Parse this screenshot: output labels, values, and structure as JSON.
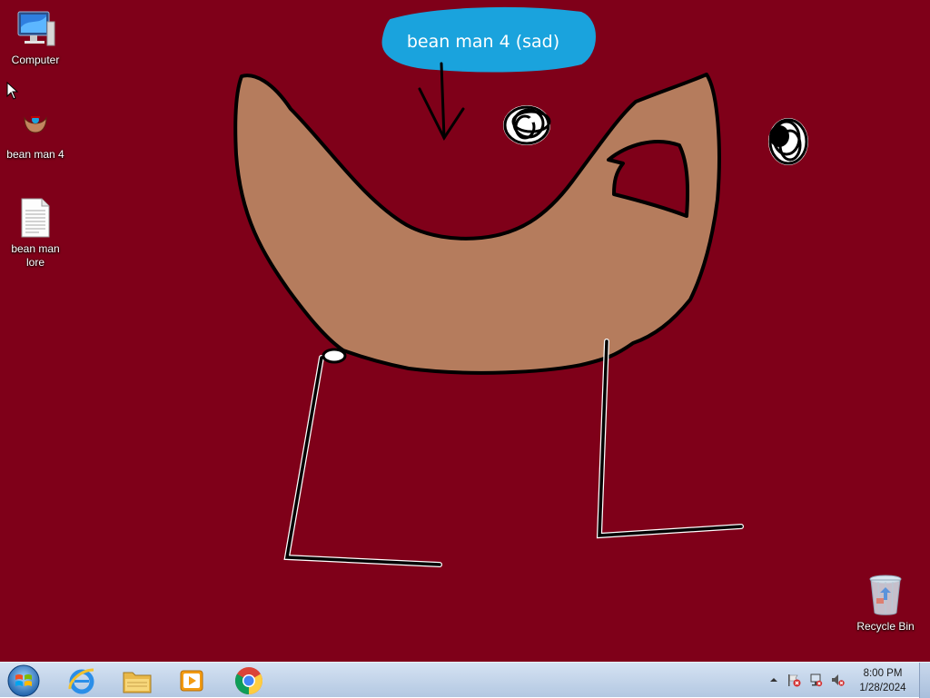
{
  "desktop": {
    "background_color": "#7f0019",
    "icons": [
      {
        "label": "Computer"
      },
      {
        "label": "bean man 4"
      },
      {
        "label": "bean man\nlore"
      },
      {
        "label": "Recycle Bin"
      }
    ]
  },
  "wallpaper": {
    "speech_bubble_text": "bean man 4 (sad)",
    "bubble_color": "#1aa3dd",
    "body_color": "#b57c5d"
  },
  "taskbar": {
    "pinned": [
      {
        "icon": "start-orb-icon"
      },
      {
        "icon": "internet-explorer-icon"
      },
      {
        "icon": "file-explorer-icon"
      },
      {
        "icon": "media-player-icon"
      },
      {
        "icon": "chrome-icon"
      }
    ],
    "tray": {
      "icons": [
        "show-hidden-icons-chevron",
        "action-center-flag-icon",
        "network-icon",
        "volume-muted-icon"
      ],
      "time": "8:00 PM",
      "date": "1/28/2024"
    }
  }
}
